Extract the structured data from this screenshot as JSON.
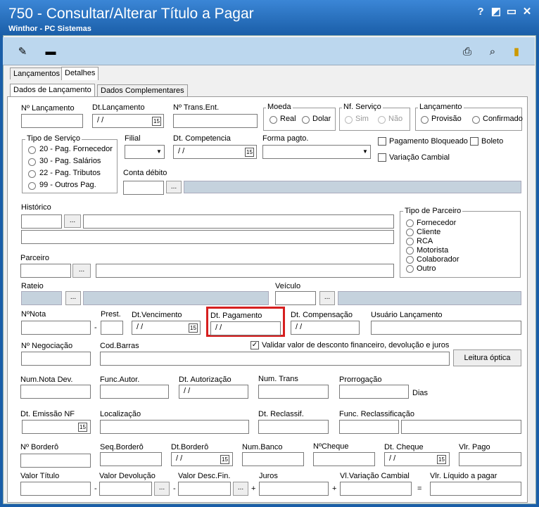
{
  "window": {
    "title": "750 - Consultar/Alterar Título a Pagar",
    "subtitle": "Winthor - PC Sistemas",
    "help": "?",
    "minimize": "◩",
    "maximize": "▭",
    "close": "✕"
  },
  "toolbar": {
    "icons": [
      "edit-icon",
      "dash-icon",
      "print-icon",
      "search-icon",
      "exit-icon"
    ]
  },
  "tabs": {
    "outer": [
      "Lançamentos",
      "Detalhes"
    ],
    "inner": [
      "Dados de Lançamento",
      "Dados Complementares"
    ]
  },
  "fields": {
    "nlanc": "Nº Lançamento",
    "dtlanc": "Dt.Lançamento",
    "ntrans": "Nº Trans.Ent.",
    "moeda": "Moeda",
    "real": "Real",
    "dolar": "Dolar",
    "nfserv": "Nf. Serviço",
    "sim": "Sim",
    "nao": "Não",
    "lancamento": "Lançamento",
    "provisao": "Provisão",
    "confirmado": "Confirmado",
    "tiposerv": "Tipo de Serviço",
    "ts1": "20 - Pag. Fornecedor",
    "ts2": "30 - Pag. Salários",
    "ts3": "22 - Pag. Tributos",
    "ts4": "99 - Outros Pag.",
    "filial": "Filial",
    "dtcomp": "Dt. Competencia",
    "formapag": "Forma pagto.",
    "pagbloq": "Pagamento Bloqueado",
    "boleto": "Boleto",
    "varcamb": "Variação Cambial",
    "contadeb": "Conta débito",
    "historico": "Histórico",
    "tipoparc": "Tipo de Parceiro",
    "p1": "Fornecedor",
    "p2": "Cliente",
    "p3": "RCA",
    "p4": "Motorista",
    "p5": "Colaborador",
    "p6": "Outro",
    "parceiro": "Parceiro",
    "rateio": "Rateio",
    "veiculo": "Veículo",
    "nnota": "NºNota",
    "prest": "Prest.",
    "dtvenc": "Dt.Vencimento",
    "dtpag": "Dt. Pagamento",
    "dtcomp2": "Dt. Compensação",
    "usuario": "Usuário Lançamento",
    "nneg": "Nº Negociação",
    "codbarras": "Cod.Barras",
    "validar": "Validar valor de desconto financeiro,  devolução e juros",
    "leitura": "Leitura óptica",
    "numnota": "Num.Nota Dev.",
    "funcaut": "Func.Autor.",
    "dtaut": "Dt. Autorização",
    "numtrans": "Num. Trans",
    "prorrog": "Prorrogação",
    "dias": "Dias",
    "dtemis": "Dt. Emissão NF",
    "local": "Localização",
    "dtreclass": "Dt. Reclassif.",
    "funcreclass": "Func. Reclassificação",
    "nbord": "Nº Borderô",
    "seqbord": "Seq.Borderô",
    "dtbord": "Dt.Borderô",
    "numbanco": "Num.Banco",
    "ncheque": "NºCheque",
    "dtcheque": "Dt. Cheque",
    "vlrpago": "Vlr. Pago",
    "valtit": "Valor Título",
    "valdev": "Valor Devolução",
    "valdesc": "Valor Desc.Fin.",
    "juros": "Juros",
    "vlvar": "Vl.Variação Cambial",
    "vlliq": "Vlr. Líquido a pagar"
  },
  "date_value": "/ /",
  "cal_icon": "15",
  "ellipsis": "...",
  "dash": "-",
  "plus": "+",
  "eq": "="
}
